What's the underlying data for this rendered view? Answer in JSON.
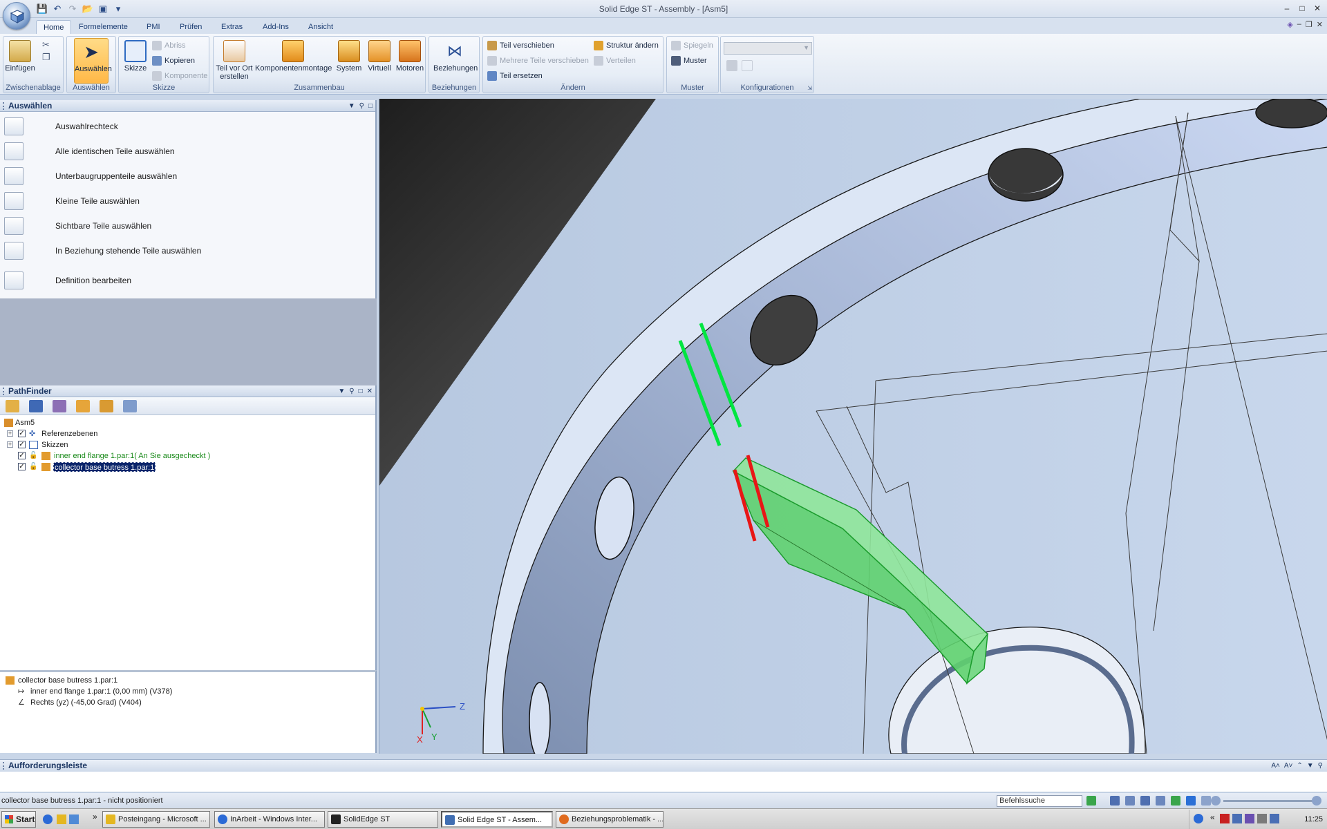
{
  "window": {
    "title": "Solid Edge ST - Assembly - [Asm5]"
  },
  "ribbon_tabs": [
    "Home",
    "Formelemente",
    "PMI",
    "Prüfen",
    "Extras",
    "Add-Ins",
    "Ansicht"
  ],
  "ribbon": {
    "zwischenablage": {
      "label": "Zwischenablage",
      "einfuegen": "Einfügen"
    },
    "auswaehlen": {
      "label": "Auswählen",
      "btn": "Auswählen"
    },
    "skizze": {
      "label": "Skizze",
      "btn": "Skizze",
      "abriss": "Abriss",
      "kopieren": "Kopieren",
      "komponente": "Komponente"
    },
    "zusammenbau": {
      "label": "Zusammenbau",
      "teil_vor_ort_1": "Teil vor Ort",
      "teil_vor_ort_2": "erstellen",
      "komponentenmontage": "Komponentenmontage",
      "system": "System",
      "virtuell": "Virtuell",
      "motoren": "Motoren"
    },
    "beziehungen": {
      "label": "Beziehungen",
      "btn": "Beziehungen"
    },
    "aendern": {
      "label": "Ändern",
      "teil_verschieben": "Teil verschieben",
      "mehrere_teile": "Mehrere Teile verschieben",
      "teil_ersetzen": "Teil ersetzen",
      "struktur_aendern": "Struktur ändern",
      "verteilen": "Verteilen"
    },
    "muster": {
      "label": "Muster",
      "spiegeln": "Spiegeln",
      "muster": "Muster"
    },
    "konfigurationen": {
      "label": "Konfigurationen"
    }
  },
  "select_panel": {
    "title": "Auswählen",
    "items": [
      "Auswahlrechteck",
      "Alle identischen Teile auswählen",
      "Unterbaugruppenteile auswählen",
      "Kleine Teile auswählen",
      "Sichtbare Teile auswählen",
      "In Beziehung stehende Teile auswählen",
      "Definition bearbeiten"
    ]
  },
  "pathfinder": {
    "title": "PathFinder",
    "root": "Asm5",
    "nodes": [
      "Referenzebenen",
      "Skizzen",
      "inner end flange 1.par:1( An Sie ausgecheckt )",
      "collector base butress 1.par:1"
    ]
  },
  "relations": {
    "part": "collector base butress 1.par:1",
    "rel1": "inner end flange 1.par:1   (0,00 mm)   (V378)",
    "rel2": "Rechts (yz)   (-45,00 Grad)   (V404)"
  },
  "viewport": {
    "axis_x": "X",
    "axis_y": "Y",
    "axis_z": "Z"
  },
  "command_bar": {
    "title": "Aufforderungsleiste"
  },
  "status": {
    "text": "collector base butress 1.par:1 - nicht positioniert",
    "search": "Befehlssuche"
  },
  "taskbar": {
    "start": "Start",
    "tasks": [
      "Posteingang - Microsoft ...",
      "InArbeit - Windows Inter...",
      "SolidEdge ST",
      "Solid Edge ST - Assem...",
      "Beziehungsproblematik - ..."
    ],
    "clock": "11:25"
  },
  "colors": {
    "selected_edge": "#00e640",
    "conflict_edge": "#e81616",
    "selection": "#0a246a",
    "ribbon_active": "#ffb847"
  }
}
